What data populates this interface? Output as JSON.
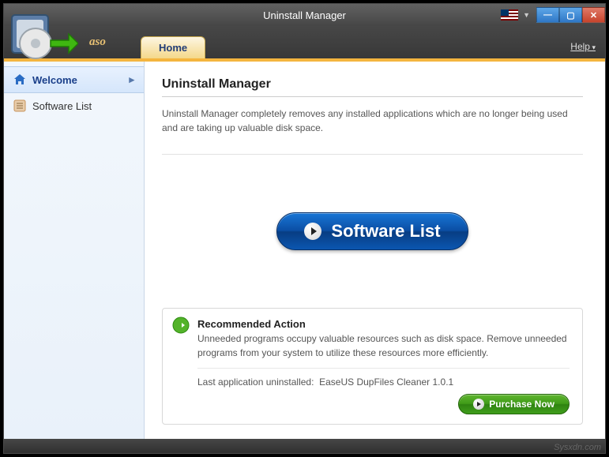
{
  "window": {
    "title": "Uninstall Manager"
  },
  "brand": "aso",
  "tabs": [
    {
      "label": "Home"
    }
  ],
  "menu": {
    "help": "Help"
  },
  "sidebar": {
    "items": [
      {
        "label": "Welcome",
        "active": true
      },
      {
        "label": "Software List",
        "active": false
      }
    ]
  },
  "main": {
    "heading": "Uninstall Manager",
    "description": "Uninstall Manager completely removes any installed applications which are no longer being used and are taking up valuable disk space.",
    "primary_button": "Software List"
  },
  "recommended": {
    "title": "Recommended Action",
    "text": "Unneeded programs occupy valuable resources such as disk space. Remove unneeded programs from your system to utilize these resources more efficiently.",
    "last_label": "Last application uninstalled:",
    "last_value": "EaseUS DupFiles Cleaner 1.0.1",
    "purchase": "Purchase Now"
  },
  "watermark": "Sysxdn.com"
}
